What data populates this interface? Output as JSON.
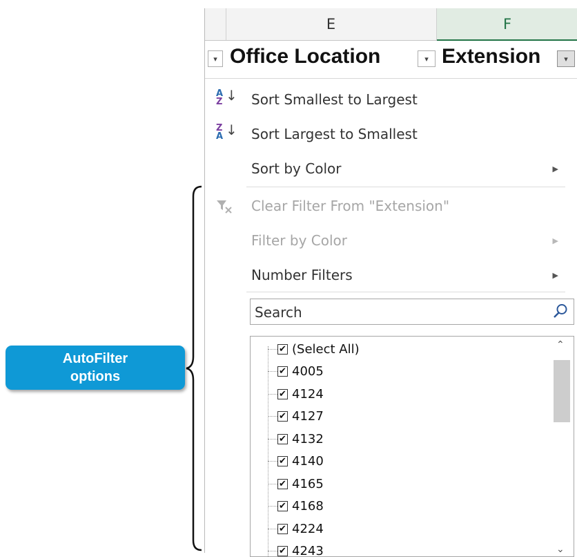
{
  "columns": {
    "e_letter": "E",
    "f_letter": "F",
    "e_title": "Office Location",
    "f_title": "Extension"
  },
  "menu": {
    "sort_asc": "Sort Smallest to Largest",
    "sort_desc": "Sort Largest to Smallest",
    "sort_by_color": "Sort by Color",
    "clear_filter": "Clear Filter From \"Extension\"",
    "filter_by_color": "Filter by Color",
    "number_filters": "Number Filters",
    "icon_sort_asc_top": "A",
    "icon_sort_asc_bottom": "Z",
    "icon_sort_desc_top": "Z",
    "icon_sort_desc_bottom": "A"
  },
  "search": {
    "placeholder": "Search"
  },
  "filter_values": [
    {
      "label": "(Select All)",
      "checked": true
    },
    {
      "label": "4005",
      "checked": true
    },
    {
      "label": "4124",
      "checked": true
    },
    {
      "label": "4127",
      "checked": true
    },
    {
      "label": "4132",
      "checked": true
    },
    {
      "label": "4140",
      "checked": true
    },
    {
      "label": "4165",
      "checked": true
    },
    {
      "label": "4168",
      "checked": true
    },
    {
      "label": "4224",
      "checked": true
    },
    {
      "label": "4243",
      "checked": true
    }
  ],
  "annotation": {
    "label": "AutoFilter\noptions",
    "color": "#0f99d6"
  },
  "colors": {
    "excel_green": "#217346",
    "disabled_text": "#a6a6a6"
  }
}
